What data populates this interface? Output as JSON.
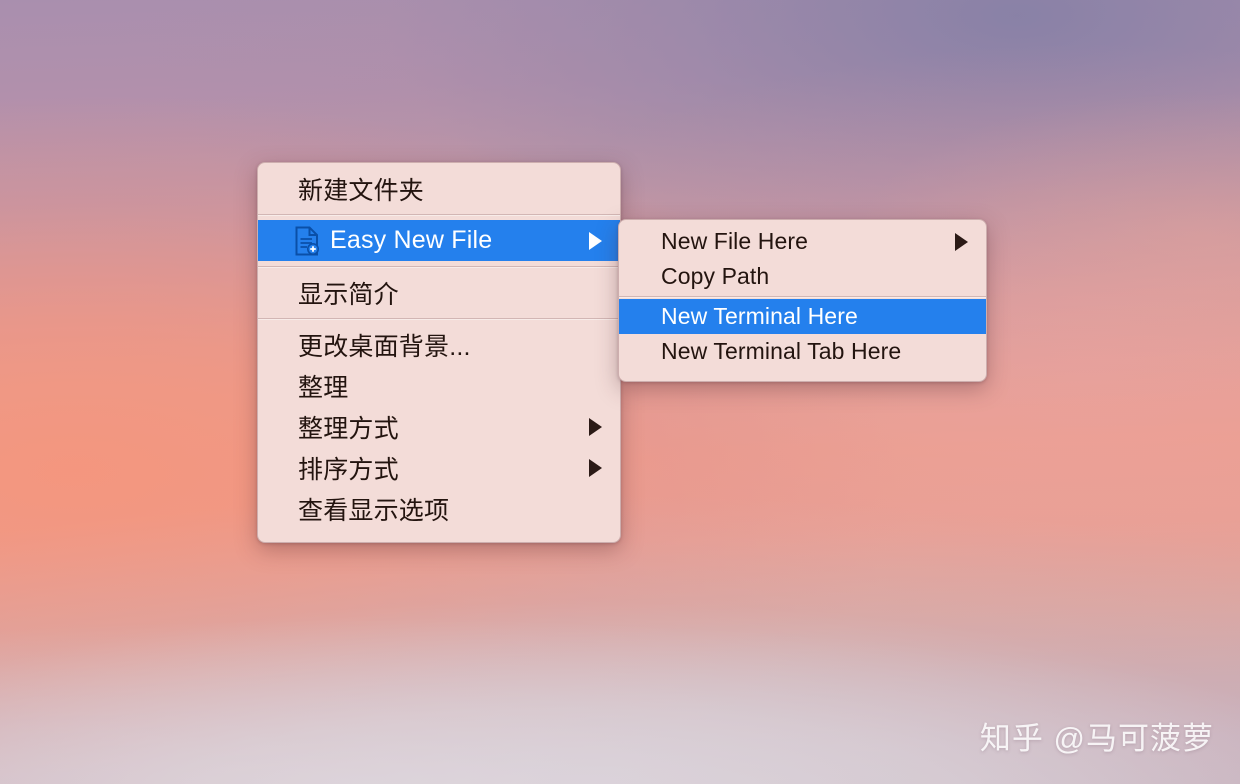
{
  "desktop": {
    "wallpaper_description": "sunset sky gradient",
    "colors": {
      "sky_top": "#a98fae",
      "sky_mid": "#f0a28d",
      "sky_bottom": "#c2acbb",
      "violet_cloud": "#8680a6",
      "coral_glow": "#f4967e"
    }
  },
  "context_menu": {
    "background": "#f3dcd8",
    "highlight": "#2480ed",
    "text_color": "#23140f",
    "groups": [
      {
        "items": [
          {
            "label": "新建文件夹",
            "icon": null,
            "submenu": false,
            "selected": false
          }
        ]
      },
      {
        "items": [
          {
            "label": "Easy New File",
            "icon": "new-document-icon",
            "submenu": true,
            "selected": true
          }
        ]
      },
      {
        "items": [
          {
            "label": "显示简介",
            "icon": null,
            "submenu": false,
            "selected": false
          }
        ]
      },
      {
        "items": [
          {
            "label": "更改桌面背景...",
            "icon": null,
            "submenu": false,
            "selected": false
          },
          {
            "label": "整理",
            "icon": null,
            "submenu": false,
            "selected": false
          },
          {
            "label": "整理方式",
            "icon": null,
            "submenu": true,
            "selected": false
          },
          {
            "label": "排序方式",
            "icon": null,
            "submenu": true,
            "selected": false
          },
          {
            "label": "查看显示选项",
            "icon": null,
            "submenu": false,
            "selected": false
          }
        ]
      }
    ]
  },
  "submenu": {
    "background": "#f3dcd8",
    "highlight": "#2480ed",
    "groups": [
      {
        "items": [
          {
            "label": "New File Here",
            "submenu": true,
            "selected": false
          },
          {
            "label": "Copy Path",
            "submenu": false,
            "selected": false
          }
        ]
      },
      {
        "items": [
          {
            "label": "New Terminal Here",
            "submenu": false,
            "selected": true
          },
          {
            "label": "New Terminal Tab Here",
            "submenu": false,
            "selected": false
          }
        ]
      }
    ]
  },
  "watermark": {
    "text": "知乎 @马可菠萝"
  }
}
